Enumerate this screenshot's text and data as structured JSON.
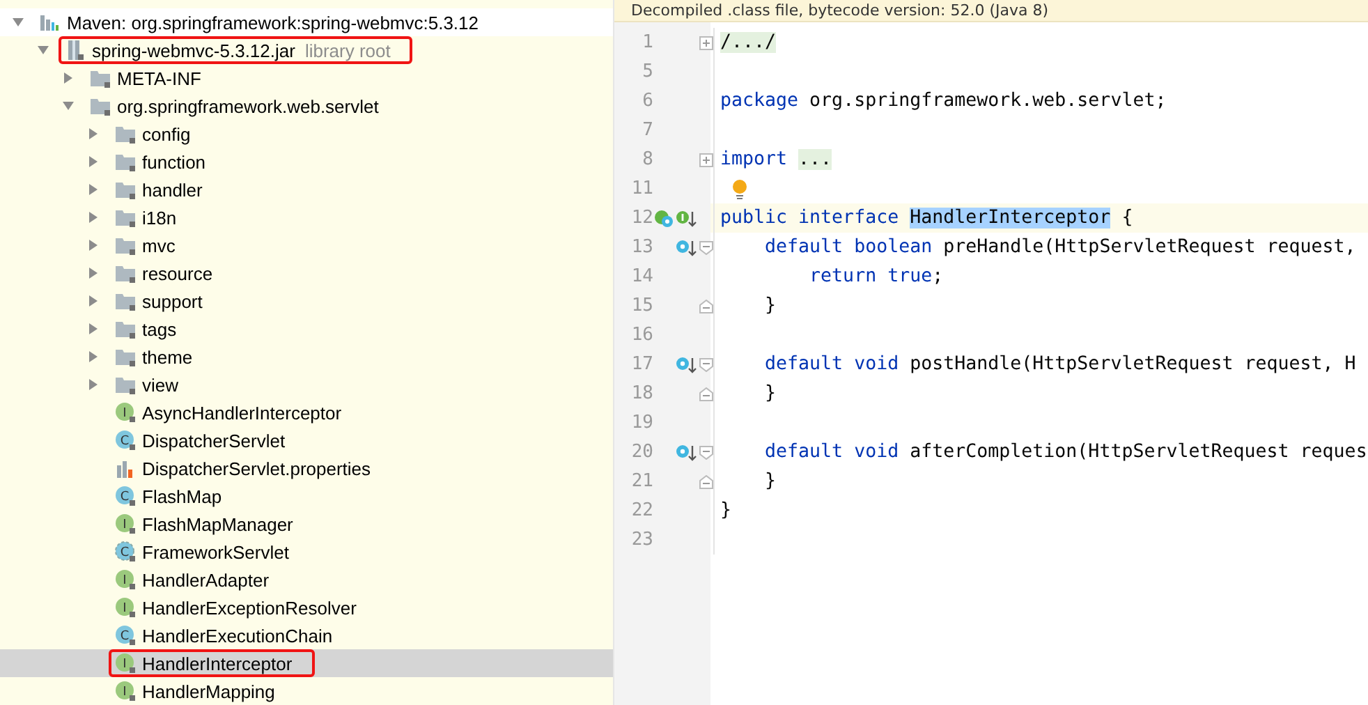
{
  "project_tree": [
    {
      "label": "Maven: org.springframework:spring-webmvc:5.3.12",
      "kind": "library",
      "expanded": true,
      "selected": false,
      "annotated": false,
      "children": [
        {
          "label": "spring-webmvc-5.3.12.jar",
          "hint": "library root",
          "kind": "jar",
          "expanded": true,
          "selected": false,
          "annotated": true,
          "children": [
            {
              "label": "META-INF",
              "kind": "folder",
              "expanded": false,
              "selected": false,
              "annotated": false
            },
            {
              "label": "org.springframework.web.servlet",
              "kind": "folder",
              "expanded": true,
              "selected": false,
              "annotated": false,
              "children": [
                {
                  "label": "config",
                  "kind": "folder",
                  "expanded": false,
                  "selected": false,
                  "annotated": false
                },
                {
                  "label": "function",
                  "kind": "folder",
                  "expanded": false,
                  "selected": false,
                  "annotated": false
                },
                {
                  "label": "handler",
                  "kind": "folder",
                  "expanded": false,
                  "selected": false,
                  "annotated": false
                },
                {
                  "label": "i18n",
                  "kind": "folder",
                  "expanded": false,
                  "selected": false,
                  "annotated": false
                },
                {
                  "label": "mvc",
                  "kind": "folder",
                  "expanded": false,
                  "selected": false,
                  "annotated": false
                },
                {
                  "label": "resource",
                  "kind": "folder",
                  "expanded": false,
                  "selected": false,
                  "annotated": false
                },
                {
                  "label": "support",
                  "kind": "folder",
                  "expanded": false,
                  "selected": false,
                  "annotated": false
                },
                {
                  "label": "tags",
                  "kind": "folder",
                  "expanded": false,
                  "selected": false,
                  "annotated": false
                },
                {
                  "label": "theme",
                  "kind": "folder",
                  "expanded": false,
                  "selected": false,
                  "annotated": false
                },
                {
                  "label": "view",
                  "kind": "folder",
                  "expanded": false,
                  "selected": false,
                  "annotated": false
                },
                {
                  "label": "AsyncHandlerInterceptor",
                  "kind": "interface",
                  "icon_letter": "I",
                  "selected": false,
                  "annotated": false
                },
                {
                  "label": "DispatcherServlet",
                  "kind": "class",
                  "icon_letter": "C",
                  "selected": false,
                  "annotated": false
                },
                {
                  "label": "DispatcherServlet.properties",
                  "kind": "properties",
                  "selected": false,
                  "annotated": false
                },
                {
                  "label": "FlashMap",
                  "kind": "class",
                  "icon_letter": "C",
                  "selected": false,
                  "annotated": false
                },
                {
                  "label": "FlashMapManager",
                  "kind": "interface",
                  "icon_letter": "I",
                  "selected": false,
                  "annotated": false
                },
                {
                  "label": "FrameworkServlet",
                  "kind": "abstract-class",
                  "icon_letter": "C",
                  "selected": false,
                  "annotated": false
                },
                {
                  "label": "HandlerAdapter",
                  "kind": "interface",
                  "icon_letter": "I",
                  "selected": false,
                  "annotated": false
                },
                {
                  "label": "HandlerExceptionResolver",
                  "kind": "interface",
                  "icon_letter": "I",
                  "selected": false,
                  "annotated": false
                },
                {
                  "label": "HandlerExecutionChain",
                  "kind": "class",
                  "icon_letter": "C",
                  "selected": false,
                  "annotated": false
                },
                {
                  "label": "HandlerInterceptor",
                  "kind": "interface",
                  "icon_letter": "I",
                  "selected": true,
                  "annotated": true
                },
                {
                  "label": "HandlerMapping",
                  "kind": "interface",
                  "icon_letter": "I",
                  "selected": false,
                  "annotated": false
                }
              ]
            }
          ]
        }
      ]
    }
  ],
  "editor": {
    "banner": "Decompiled .class file, bytecode version: 52.0 (Java 8)",
    "lines": [
      {
        "number": "1",
        "folded": true,
        "segments": [
          {
            "text": "/.../",
            "kind": "folded"
          }
        ]
      },
      {
        "number": "5"
      },
      {
        "number": "6",
        "segments": [
          {
            "text": "package ",
            "kind": "keyword"
          },
          {
            "text": "org.springframework.web.servlet;",
            "kind": "plain"
          }
        ]
      },
      {
        "number": "7"
      },
      {
        "number": "8",
        "folded": true,
        "segments": [
          {
            "text": "import ",
            "kind": "keyword"
          },
          {
            "text": "...",
            "kind": "folded"
          }
        ]
      },
      {
        "number": "11",
        "intention": true
      },
      {
        "number": "12",
        "current": true,
        "implemented_marker": true,
        "implements_marker": true,
        "segments": [
          {
            "text": "public interface ",
            "kind": "keyword"
          },
          {
            "text": "HandlerInterceptor",
            "kind": "highlight"
          },
          {
            "text": " {",
            "kind": "plain"
          }
        ]
      },
      {
        "number": "13",
        "overridden_marker": true,
        "fold_start": true,
        "segments": [
          {
            "text": "    default boolean",
            "kind": "keyword"
          },
          {
            "text": " preHandle(HttpServletRequest request,",
            "kind": "plain"
          }
        ]
      },
      {
        "number": "14",
        "segments": [
          {
            "text": "        return true",
            "kind": "keyword"
          },
          {
            "text": ";",
            "kind": "plain"
          }
        ]
      },
      {
        "number": "15",
        "fold_end": true,
        "segments": [
          {
            "text": "    }",
            "kind": "plain"
          }
        ]
      },
      {
        "number": "16"
      },
      {
        "number": "17",
        "overridden_marker": true,
        "fold_start": true,
        "segments": [
          {
            "text": "    default void",
            "kind": "keyword"
          },
          {
            "text": " postHandle(HttpServletRequest request, H",
            "kind": "plain"
          }
        ]
      },
      {
        "number": "18",
        "fold_end": true,
        "segments": [
          {
            "text": "    }",
            "kind": "plain"
          }
        ]
      },
      {
        "number": "19"
      },
      {
        "number": "20",
        "overridden_marker": true,
        "fold_start": true,
        "segments": [
          {
            "text": "    default void",
            "kind": "keyword"
          },
          {
            "text": " afterCompletion(HttpServletRequest reques",
            "kind": "plain"
          }
        ]
      },
      {
        "number": "21",
        "fold_end": true,
        "segments": [
          {
            "text": "    }",
            "kind": "plain"
          }
        ]
      },
      {
        "number": "22",
        "segments": [
          {
            "text": "}",
            "kind": "plain"
          }
        ]
      },
      {
        "number": "23"
      }
    ]
  }
}
